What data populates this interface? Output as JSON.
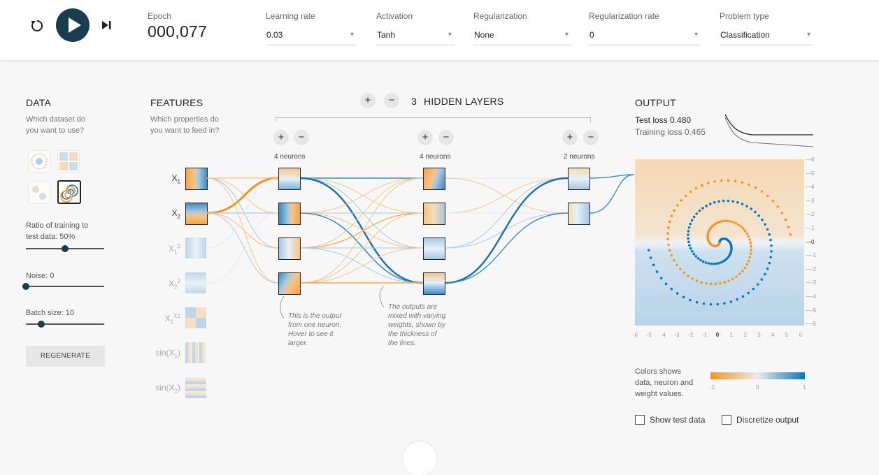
{
  "controls": {
    "reset_icon": "reset-icon",
    "play_icon": "play-icon",
    "step_icon": "step-icon"
  },
  "epoch": {
    "label": "Epoch",
    "value": "000,077"
  },
  "learning_rate": {
    "label": "Learning rate",
    "value": "0.03"
  },
  "activation": {
    "label": "Activation",
    "value": "Tanh"
  },
  "regularization": {
    "label": "Regularization",
    "value": "None"
  },
  "regularization_rate": {
    "label": "Regularization rate",
    "value": "0"
  },
  "problem_type": {
    "label": "Problem type",
    "value": "Classification"
  },
  "data": {
    "title": "DATA",
    "subtitle_1": "Which dataset do",
    "subtitle_2": "you want to use?",
    "ratio_label_1": "Ratio of training to",
    "ratio_label_2": "test data:  50%",
    "ratio_value": 0.5,
    "noise_label": "Noise:  0",
    "noise_value": 0,
    "batch_label": "Batch size:  10",
    "batch_value": 0.2,
    "regenerate": "REGENERATE"
  },
  "features": {
    "title": "FEATURES",
    "subtitle_1": "Which properties do",
    "subtitle_2": "you want to feed in?",
    "items": [
      {
        "base": "X",
        "sub": "1",
        "sup": ""
      },
      {
        "base": "X",
        "sub": "2",
        "sup": ""
      },
      {
        "base": "X",
        "sub": "1",
        "sup": "2"
      },
      {
        "base": "X",
        "sub": "2",
        "sup": "2"
      },
      {
        "base": "X",
        "sub": "1",
        "sup": "X2"
      },
      {
        "base": "sin(X",
        "sub": "1",
        "sup": ")"
      },
      {
        "base": "sin(X",
        "sub": "2",
        "sup": ")"
      }
    ]
  },
  "hidden_layers": {
    "plus": "+",
    "minus": "−",
    "count": "3",
    "label": "HIDDEN LAYERS",
    "layer1": "4 neurons",
    "layer2": "4 neurons",
    "layer3": "2 neurons"
  },
  "notes": {
    "n1_1": "This is the output",
    "n1_2": "from one neuron.",
    "n1_3": "Hover to see it",
    "n1_4": "larger.",
    "n2_1": "The outputs are",
    "n2_2": "mixed with varying",
    "n2_3": "weights, shown by",
    "n2_4": "the thickness of",
    "n2_5": "the lines."
  },
  "output": {
    "title": "OUTPUT",
    "test_loss": "Test loss 0.480",
    "training_loss": "Training loss 0.465",
    "y_ticks": [
      "6",
      "5",
      "4",
      "3",
      "2",
      "1",
      "0",
      "-1",
      "-2",
      "-3",
      "-4",
      "-5",
      "-6"
    ],
    "x_ticks": [
      "-6",
      "-5",
      "-4",
      "-3",
      "-2",
      "-1",
      "0",
      "1",
      "2",
      "3",
      "4",
      "5",
      "6"
    ],
    "legend_1": "Colors shows",
    "legend_2": "data, neuron and",
    "legend_3": "weight values.",
    "scale_min": "-1",
    "scale_mid": "0",
    "scale_max": "1",
    "show_test": "Show test data",
    "discretize": "Discretize output"
  },
  "colors": {
    "orange": "#f59322",
    "blue": "#0877bd",
    "dark": "#183d4e"
  }
}
